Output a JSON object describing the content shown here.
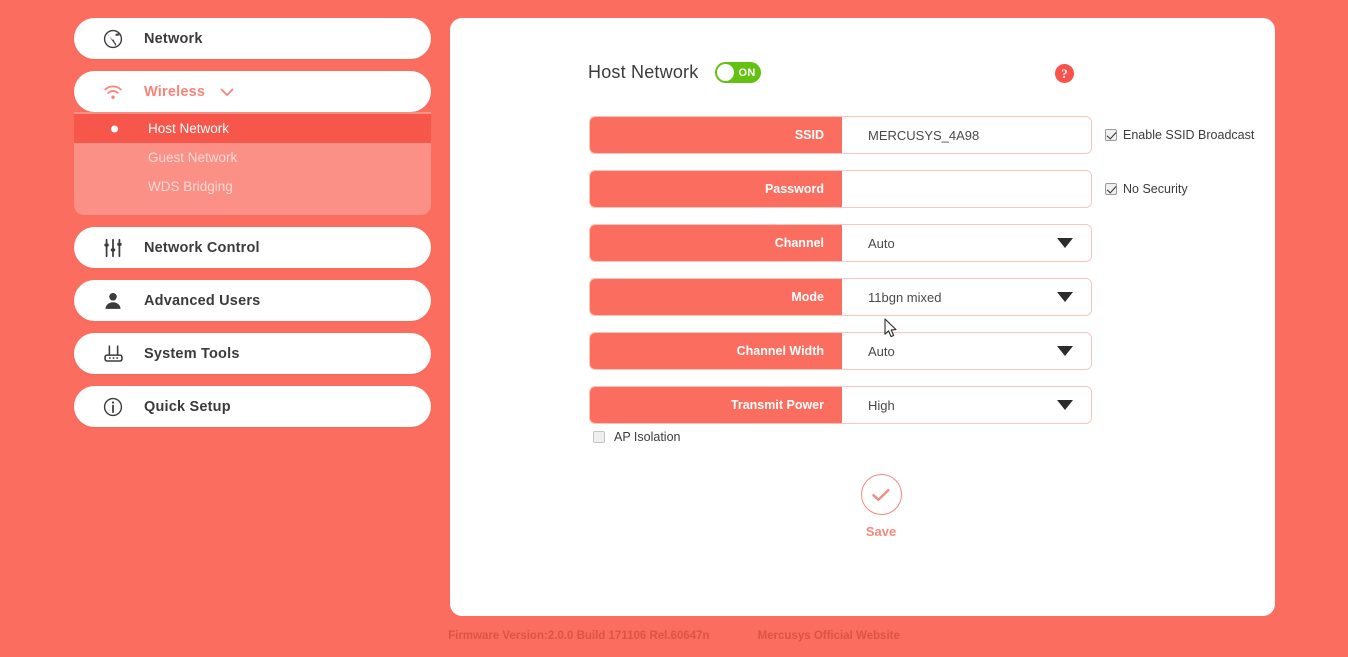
{
  "theme": {
    "background": "#fb6d5e",
    "panel_bg": "#ffffff",
    "accent": "#fb6d5e",
    "submenu_bg": "#fa9086",
    "submenu_active": "#f7564a",
    "toggle_on": "#63c211",
    "save_color": "#f4897e",
    "footer_text": "#dc5447"
  },
  "sidebar": {
    "items": [
      {
        "label": "Network",
        "icon": "globe-icon",
        "name": "network"
      },
      {
        "label": "Wireless",
        "icon": "wifi-icon",
        "name": "wireless",
        "expanded": true,
        "chevron": "chevron-down-icon"
      },
      {
        "label": "Network Control",
        "icon": "sliders-icon",
        "name": "network-control"
      },
      {
        "label": "Advanced Users",
        "icon": "user-icon",
        "name": "advanced-users"
      },
      {
        "label": "System Tools",
        "icon": "router-icon",
        "name": "system-tools"
      },
      {
        "label": "Quick Setup",
        "icon": "info-icon",
        "name": "quick-setup"
      }
    ],
    "submenu": [
      {
        "label": "Host Network",
        "active": true
      },
      {
        "label": "Guest Network",
        "active": false
      },
      {
        "label": "WDS Bridging",
        "active": false
      }
    ]
  },
  "main": {
    "title": "Host Network",
    "toggle": {
      "state_label": "ON",
      "on": true
    },
    "help_icon": "?",
    "rows": [
      {
        "label": "SSID",
        "value": "MERCUSYS_4A98",
        "type": "text"
      },
      {
        "label": "Password",
        "value": "",
        "type": "text",
        "placeholder": ""
      },
      {
        "label": "Channel",
        "value": "Auto",
        "type": "select"
      },
      {
        "label": "Mode",
        "value": "11bgn mixed",
        "type": "select"
      },
      {
        "label": "Channel Width",
        "value": "Auto",
        "type": "select"
      },
      {
        "label": "Transmit Power",
        "value": "High",
        "type": "select"
      }
    ],
    "side_checkboxes": [
      {
        "label": "Enable SSID Broadcast",
        "checked": true
      },
      {
        "label": "No Security",
        "checked": true
      }
    ],
    "ap_isolation": {
      "label": "AP Isolation",
      "checked": false
    },
    "save": {
      "label": "Save",
      "icon": "check-icon"
    }
  },
  "footer": {
    "firmware": "Firmware Version:2.0.0 Build 171106 Rel.60647n",
    "website": "Mercusys Official Website"
  }
}
